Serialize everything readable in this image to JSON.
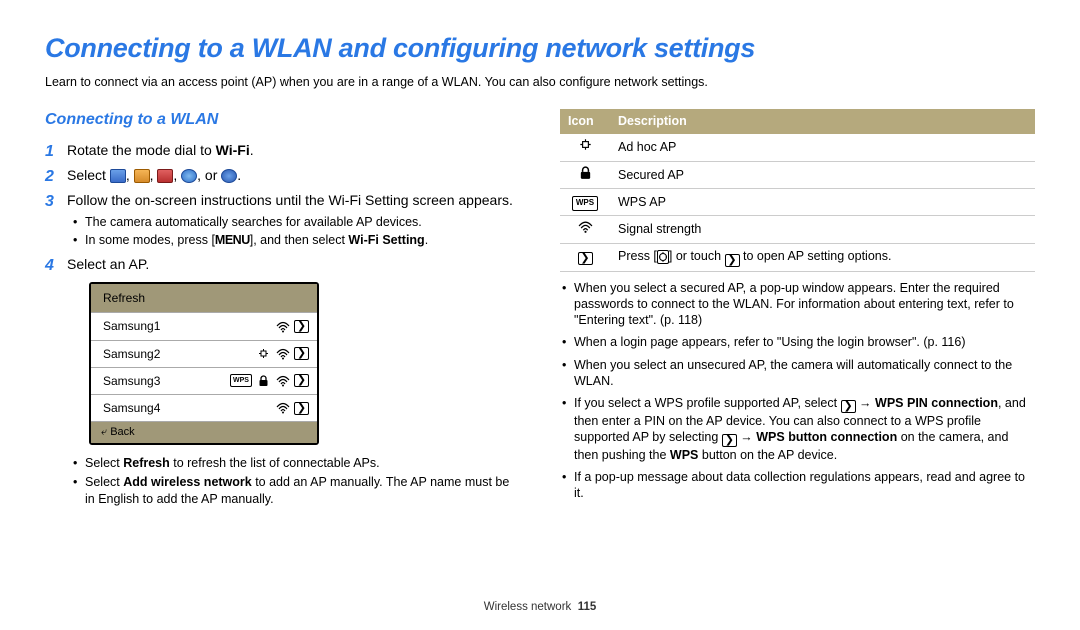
{
  "title": "Connecting to a WLAN and configuring network settings",
  "intro": "Learn to connect via an access point (AP) when you are in a range of a WLAN. You can also configure network settings.",
  "section_heading": "Connecting to a WLAN",
  "steps": {
    "s1_a": "Rotate the mode dial to ",
    "s1_wifi": "Wi-Fi",
    "s1_b": ".",
    "s2_a": "Select ",
    "s2_b": ", or ",
    "s2_c": ".",
    "s3": "Follow the on-screen instructions until the Wi-Fi Setting screen appears.",
    "s3_sub1": "The camera automatically searches for available AP devices.",
    "s3_sub2a": "In some modes, press [",
    "s3_menu": "MENU",
    "s3_sub2b": "], and then select ",
    "s3_wifi_setting": "Wi-Fi Setting",
    "s3_sub2c": ".",
    "s4": "Select an AP."
  },
  "ap_box": {
    "refresh": "Refresh",
    "rows": [
      "Samsung1",
      "Samsung2",
      "Samsung3",
      "Samsung4"
    ],
    "back": "Back"
  },
  "step4_subs": {
    "a1": "Select ",
    "a_bold": "Refresh",
    "a2": " to refresh the list of connectable APs.",
    "b1": "Select ",
    "b_bold": "Add wireless network",
    "b2": " to add an AP manually. The AP name must be in English to add the AP manually."
  },
  "table": {
    "h1": "Icon",
    "h2": "Description",
    "r1": "Ad hoc AP",
    "r2": "Secured AP",
    "r3": "WPS AP",
    "r4": "Signal strength",
    "r5a": "Press [",
    "r5b": "] or touch ",
    "r5c": " to open AP setting options."
  },
  "right_bullets": {
    "b1": "When you select a secured AP, a pop-up window appears. Enter the required passwords to connect to the WLAN. For information about entering text, refer to \"Entering text\". (p. 118)",
    "b2": "When a login page appears, refer to \"Using the login browser\". (p. 116)",
    "b3": "When you select an unsecured AP, the camera will automatically connect to the WLAN.",
    "b4a": "If you select a WPS profile supported AP, select ",
    "b4_arrow": " → ",
    "b4_bold1": "WPS PIN connection",
    "b4b": ", and then enter a PIN on the AP device. You can also connect to a WPS profile supported AP by selecting ",
    "b4_bold2": "WPS button connection",
    "b4c": " on the camera, and then pushing the ",
    "b4_bold3": "WPS",
    "b4d": " button on the AP device.",
    "b5": "If a pop-up message about data collection regulations appears, read and agree to it."
  },
  "footer": {
    "section": "Wireless network",
    "page": "115"
  }
}
